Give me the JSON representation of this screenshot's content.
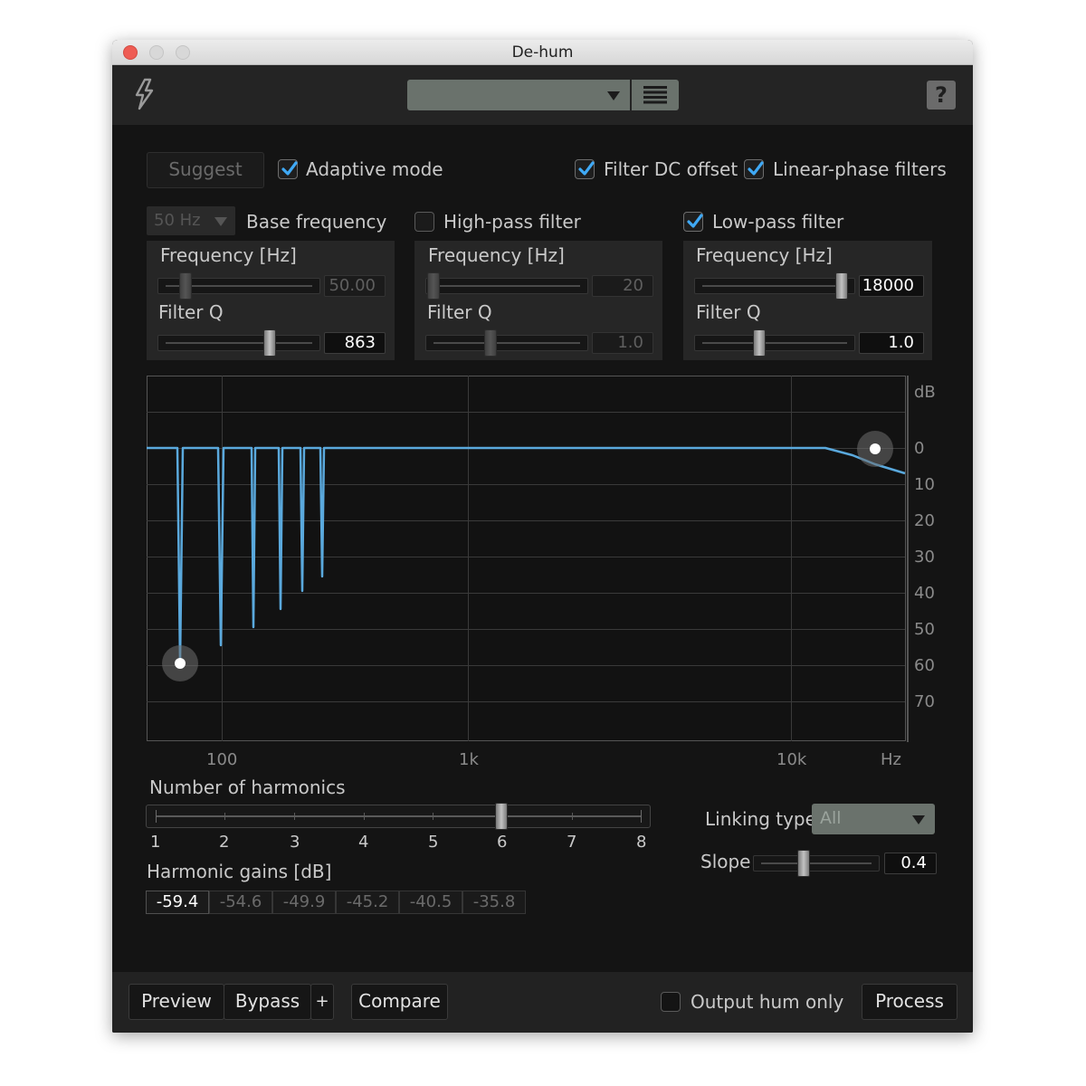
{
  "window": {
    "title": "De-hum"
  },
  "toolbar": {
    "preset_value": "",
    "help_label": "?"
  },
  "options": {
    "suggest_label": "Suggest",
    "adaptive_mode_label": "Adaptive mode",
    "adaptive_mode_checked": true,
    "filter_dc_label": "Filter DC offset",
    "filter_dc_checked": true,
    "linear_phase_label": "Linear-phase filters",
    "linear_phase_checked": true
  },
  "base": {
    "dropdown_value": "50 Hz",
    "title": "Base frequency",
    "frequency_label": "Frequency [Hz]",
    "frequency_value": "50.00",
    "q_label": "Filter Q",
    "q_value": "863"
  },
  "highpass": {
    "title": "High-pass filter",
    "checked": false,
    "frequency_label": "Frequency [Hz]",
    "frequency_value": "20",
    "q_label": "Filter Q",
    "q_value": "1.0"
  },
  "lowpass": {
    "title": "Low-pass filter",
    "checked": true,
    "frequency_label": "Frequency [Hz]",
    "frequency_value": "18000",
    "q_label": "Filter Q",
    "q_value": "1.0"
  },
  "graph": {
    "db_label": "dB",
    "hz_label": "Hz",
    "y_ticks": [
      "0",
      "10",
      "20",
      "30",
      "40",
      "50",
      "60",
      "70"
    ],
    "x_ticks": [
      "100",
      "1k",
      "10k"
    ],
    "curve_color": "#5aa9dd"
  },
  "harmonics": {
    "label": "Number of harmonics",
    "value": 6,
    "ticks": [
      "1",
      "2",
      "3",
      "4",
      "5",
      "6",
      "7",
      "8"
    ],
    "gains_label": "Harmonic gains [dB]",
    "gains": [
      "-59.4",
      "-54.6",
      "-49.9",
      "-45.2",
      "-40.5",
      "-35.8"
    ]
  },
  "linking": {
    "label": "Linking type",
    "value": "All",
    "slope_label": "Slope",
    "slope_value": "0.4"
  },
  "footer": {
    "preview_label": "Preview",
    "bypass_label": "Bypass",
    "plus_label": "+",
    "compare_label": "Compare",
    "output_hum_label": "Output hum only",
    "output_hum_checked": false,
    "process_label": "Process"
  }
}
